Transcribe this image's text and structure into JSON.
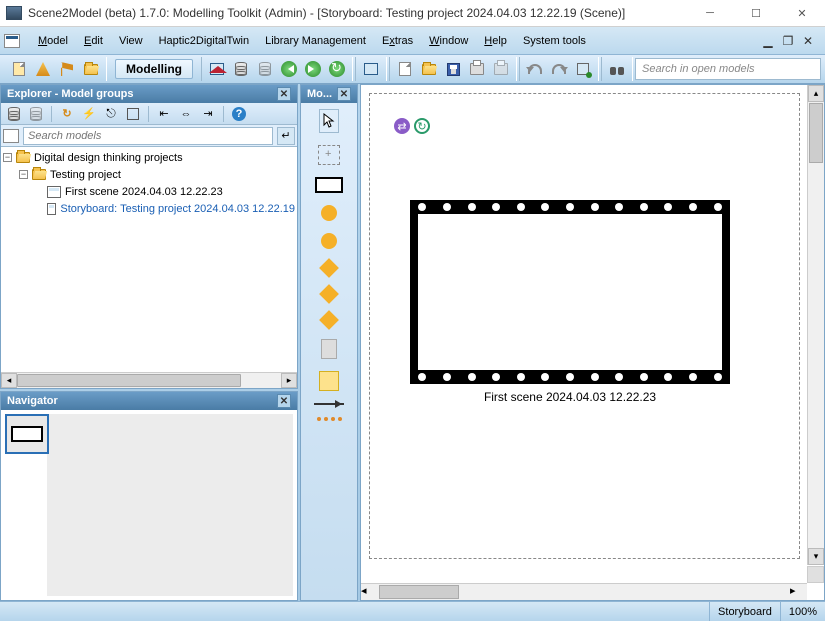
{
  "title": "Scene2Model (beta) 1.7.0: Modelling Toolkit (Admin) - [Storyboard: Testing project 2024.04.03 12.22.19 (Scene)]",
  "menu": {
    "model": "Model",
    "edit": "Edit",
    "view": "View",
    "haptic": "Haptic2DigitalTwin",
    "library": "Library Management",
    "extras": "Extras",
    "window": "Window",
    "help": "Help",
    "system": "System tools"
  },
  "mode_label": "Modelling",
  "search_placeholder": "Search in open models",
  "explorer": {
    "title": "Explorer - Model groups",
    "search_placeholder": "Search models",
    "root": "Digital design thinking projects",
    "folder": "Testing project",
    "item1": "First scene 2024.04.03 12.22.23",
    "item2": "Storyboard: Testing project 2024.04.03 12.22.19"
  },
  "toolbox_title": "Mo...",
  "navigator_title": "Navigator",
  "canvas": {
    "caption": "First scene 2024.04.03 12.22.23"
  },
  "status": {
    "mode": "Storyboard",
    "zoom": "100%"
  }
}
